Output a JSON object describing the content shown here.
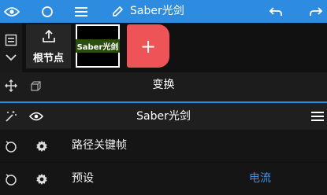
{
  "topbar": {
    "title": "Saber光剑",
    "icons": [
      "eye-icon",
      "circle-icon",
      "menu-icon",
      "pencil-icon",
      "undo-icon",
      "redo-icon"
    ]
  },
  "layers": {
    "root_label": "根节点",
    "thumbnail_label": "Saber光剑",
    "add_label": "+"
  },
  "transform": {
    "title": "变换"
  },
  "effect": {
    "title": "Saber光剑"
  },
  "properties": [
    {
      "label": "路径关键帧",
      "value": ""
    },
    {
      "label": "预设",
      "value": "电流"
    }
  ],
  "colors": {
    "accent": "#2d8be0",
    "add_button": "#ee5457",
    "value_text": "#3f8fe6",
    "thumbnail_label_bg": "#2c4e0b"
  }
}
